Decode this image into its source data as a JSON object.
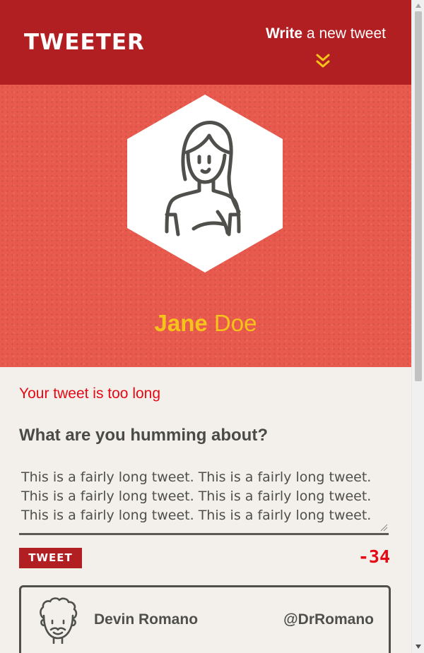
{
  "header": {
    "brand": "TWEETER",
    "write_strong": "Write",
    "write_rest": " a new tweet",
    "chevron_icon": "double-chevron-down-icon",
    "colors": {
      "background": "#b11f23",
      "chevron": "#f6c31a"
    }
  },
  "profile": {
    "avatar_icon": "woman-avatar-icon",
    "first_name": "Jane",
    "last_name": "Doe",
    "colors": {
      "background": "#e85a4d",
      "name": "#f6c31a"
    }
  },
  "compose": {
    "error": "Your tweet is too long",
    "prompt": "What are you humming about?",
    "text": "This is a fairly long tweet. This is a fairly long tweet. This is a fairly long tweet. This is a fairly long tweet. This is a fairly long tweet. This is a fairly long tweet.",
    "button_label": "TWEET",
    "counter": "-34",
    "colors": {
      "error": "#e50914",
      "button": "#b11f23"
    }
  },
  "tweets": [
    {
      "avatar_icon": "man-avatar-icon",
      "name": "Devin Romano",
      "handle": "@DrRomano"
    }
  ]
}
